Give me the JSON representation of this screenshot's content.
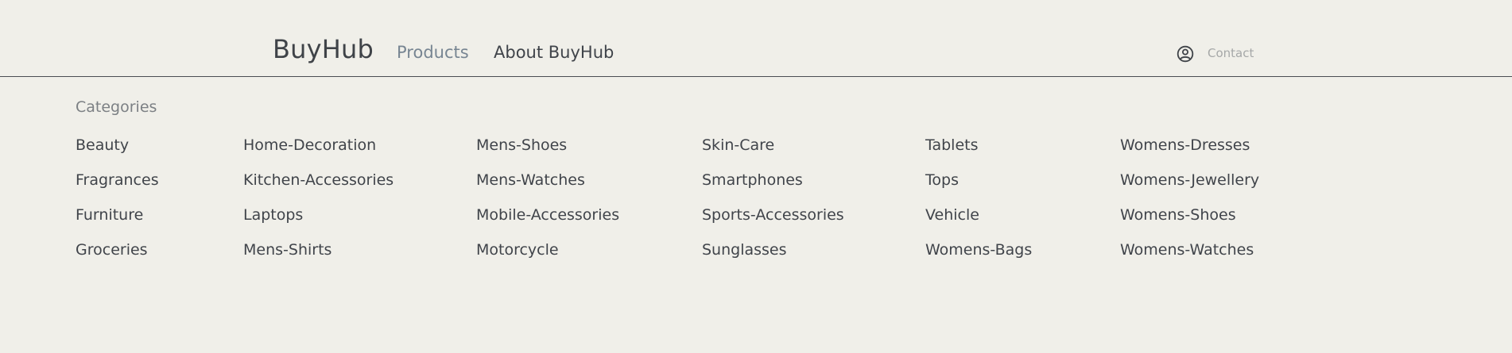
{
  "header": {
    "logo": "BuyHub",
    "nav": {
      "products": "Products",
      "about": "About BuyHub"
    },
    "user_icon": "user-circle-icon",
    "contact": "Contact"
  },
  "categories": {
    "title": "Categories",
    "items": [
      "Beauty",
      "Fragrances",
      "Furniture",
      "Groceries",
      "Home-Decoration",
      "Kitchen-Accessories",
      "Laptops",
      "Mens-Shirts",
      "Mens-Shoes",
      "Mens-Watches",
      "Mobile-Accessories",
      "Motorcycle",
      "Skin-Care",
      "Smartphones",
      "Sports-Accessories",
      "Sunglasses",
      "Tablets",
      "Tops",
      "Vehicle",
      "Womens-Bags",
      "Womens-Dresses",
      "Womens-Jewellery",
      "Womens-Shoes",
      "Womens-Watches"
    ]
  }
}
